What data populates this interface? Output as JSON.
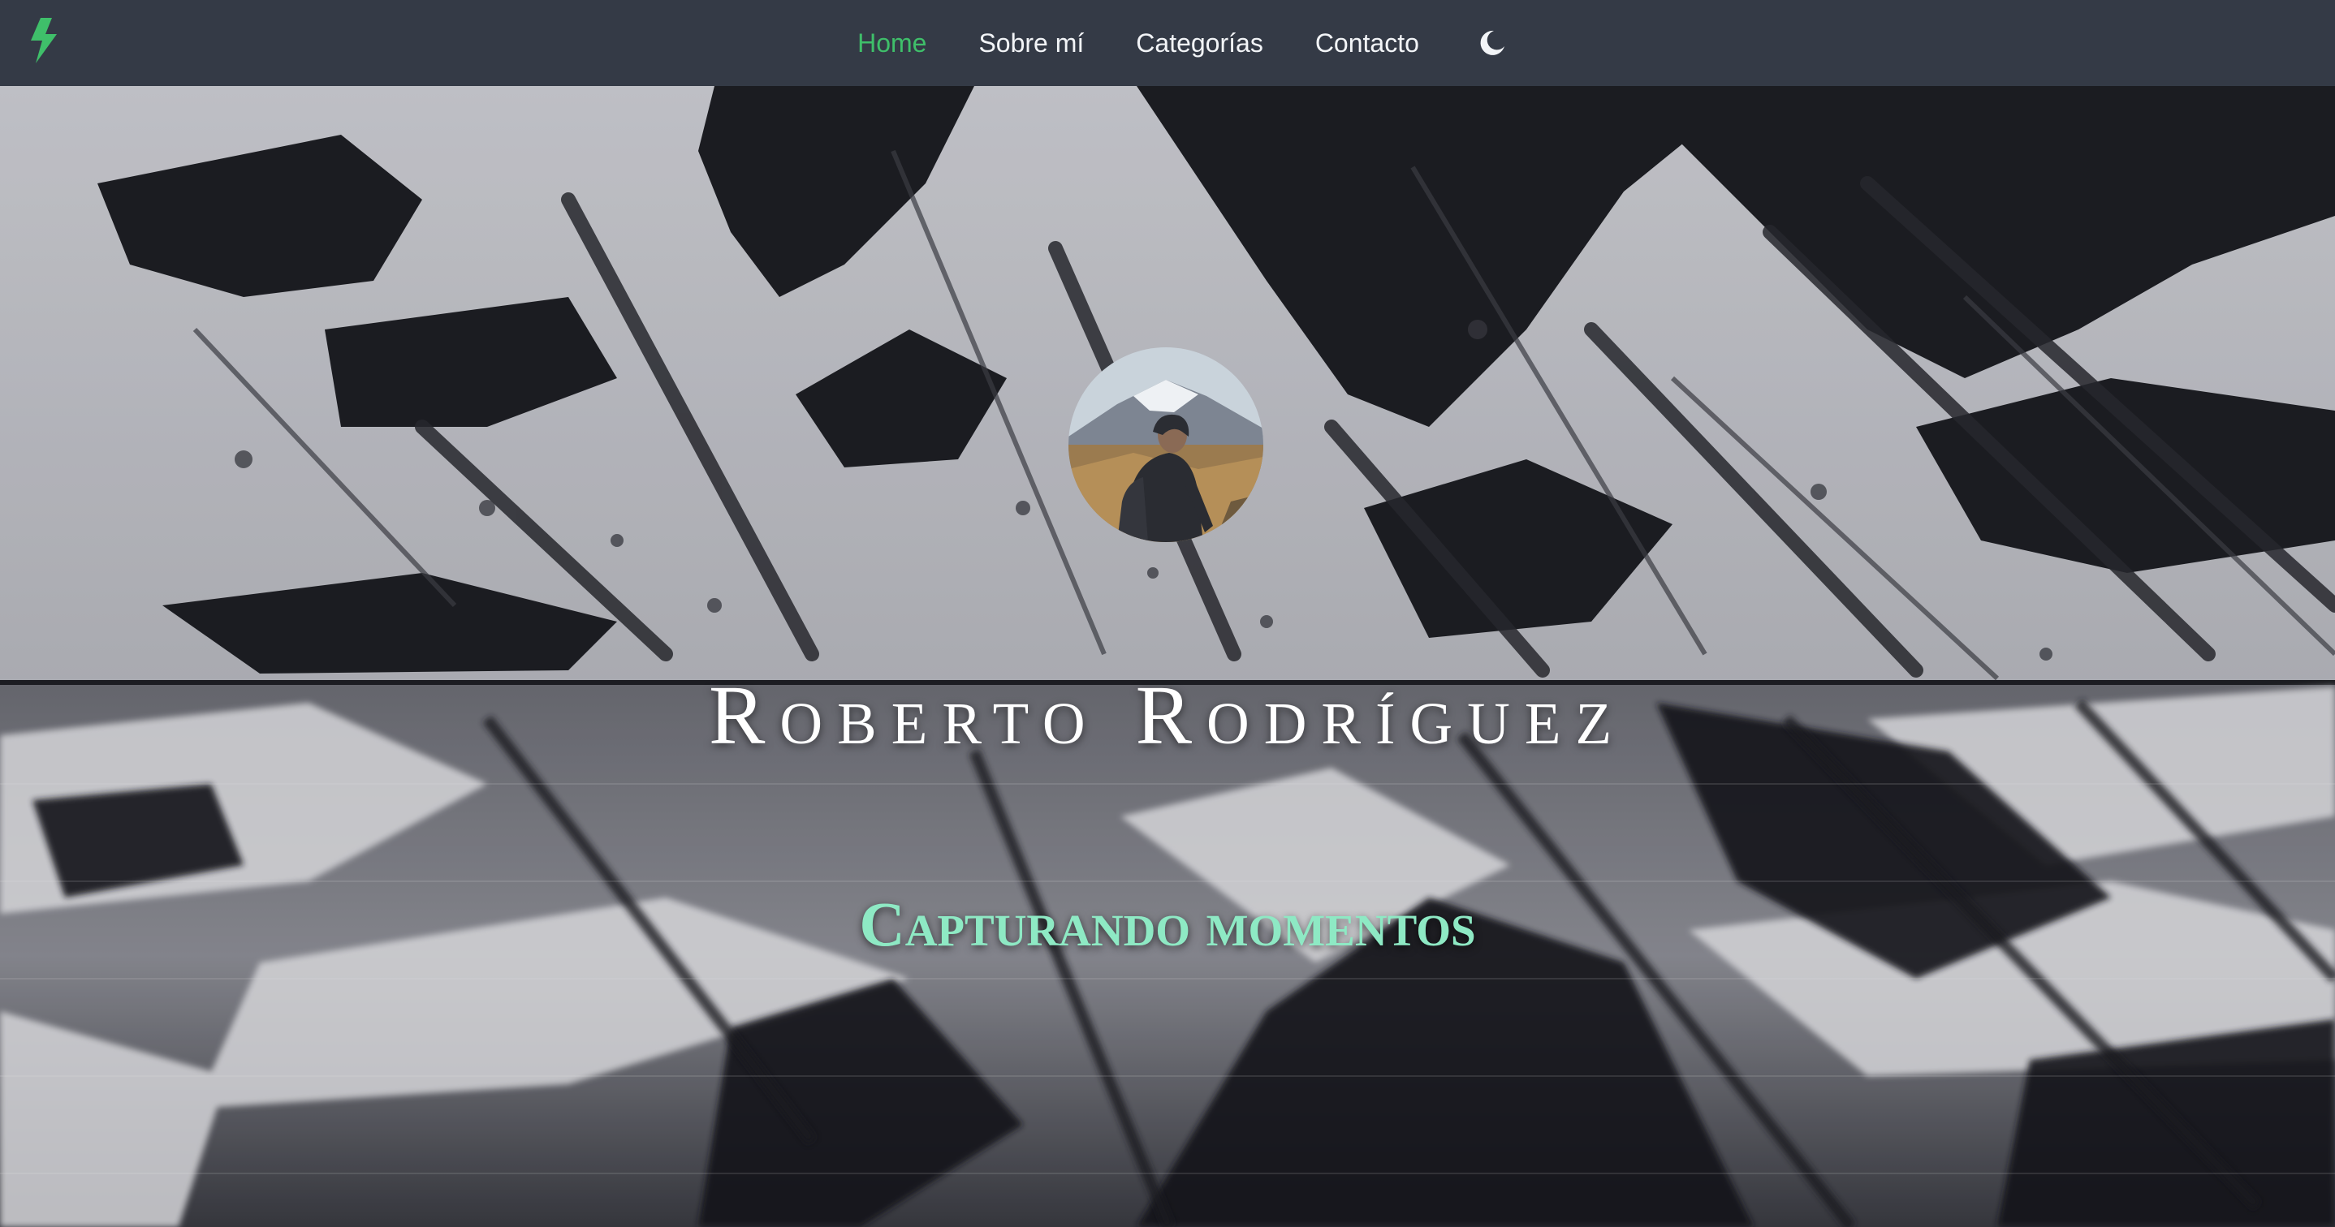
{
  "navbar": {
    "brand_icon": "lightning-bolt-icon",
    "brand_color": "#3fbf6a",
    "links": [
      {
        "label": "Home",
        "active": true
      },
      {
        "label": "Sobre mí",
        "active": false
      },
      {
        "label": "Categorías",
        "active": false
      },
      {
        "label": "Contacto",
        "active": false
      }
    ],
    "theme_toggle_icon": "moon-icon",
    "active_color": "#3fbf6a",
    "background_color": "#343a46"
  },
  "hero": {
    "background": "snowy-mountain-lake-reflection",
    "avatar": "profile-photo",
    "title": "Roberto Rodríguez",
    "subtitle": "Capturando momentos",
    "subtitle_color": "#8ee9c4"
  }
}
